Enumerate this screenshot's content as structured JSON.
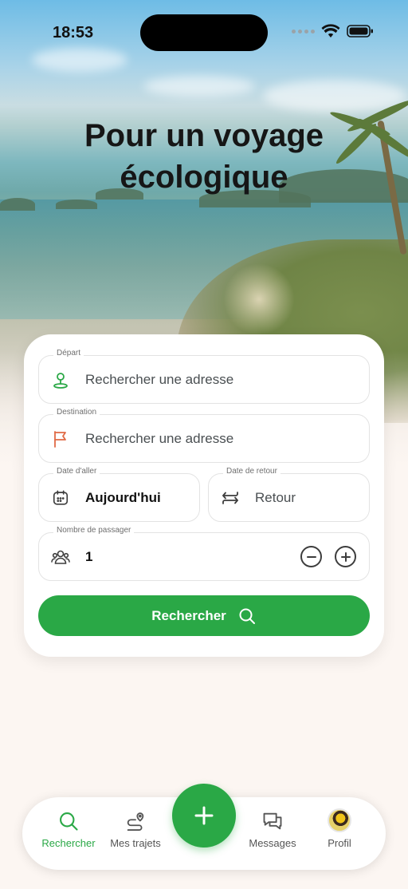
{
  "status_bar": {
    "time": "18:53"
  },
  "hero": {
    "title_line1": "Pour un voyage",
    "title_line2": "écologique"
  },
  "form": {
    "departure": {
      "label": "Départ",
      "placeholder": "Rechercher une adresse"
    },
    "destination": {
      "label": "Destination",
      "placeholder": "Rechercher une adresse"
    },
    "date_out": {
      "label": "Date d'aller",
      "value": "Aujourd'hui"
    },
    "date_return": {
      "label": "Date de retour",
      "value": "Retour"
    },
    "passengers": {
      "label": "Nombre de passager",
      "value": "1"
    },
    "search_button": "Rechercher"
  },
  "nav": {
    "items": [
      {
        "label": "Rechercher",
        "icon": "search-icon",
        "active": true
      },
      {
        "label": "Mes trajets",
        "icon": "route-icon",
        "active": false
      },
      {
        "label": "Messages",
        "icon": "chat-icon",
        "active": false
      },
      {
        "label": "Profil",
        "icon": "avatar",
        "active": false
      }
    ],
    "fab_icon": "plus-icon"
  },
  "colors": {
    "accent": "#2aa846",
    "flag": "#e06a45",
    "background": "#fcf6f2"
  }
}
